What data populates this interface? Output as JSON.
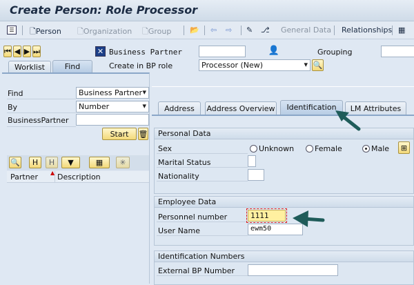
{
  "title": "Create Person: Role Processor",
  "toolbar": {
    "person": "Person",
    "organization": "Organization",
    "group": "Group",
    "general_data": "General Data",
    "relationships": "Relationships"
  },
  "header": {
    "bp_label": "Business Partner",
    "bp_value": "",
    "grouping_label": "Grouping",
    "grouping_value": "",
    "role_label": "Create in BP role",
    "role_value": "Processor (New)"
  },
  "left": {
    "tabs": [
      "Worklist",
      "Find"
    ],
    "active_tab": "Find",
    "find_label": "Find",
    "find_value": "Business Partner",
    "by_label": "By",
    "by_value": "Number",
    "bp_label": "BusinessPartner",
    "bp_value": "",
    "start": "Start",
    "columns": [
      "Partner",
      "Description"
    ]
  },
  "tabs": {
    "items": [
      "Address",
      "Address Overview",
      "Identification",
      "LM Attributes"
    ],
    "active": "Identification"
  },
  "personal": {
    "title": "Personal Data",
    "sex_label": "Sex",
    "sex_options": [
      "Unknown",
      "Female",
      "Male"
    ],
    "sex_selected": "Male",
    "marital_label": "Marital Status",
    "marital_value": "",
    "nationality_label": "Nationality",
    "nationality_value": ""
  },
  "employee": {
    "title": "Employee Data",
    "personnel_label": "Personnel number",
    "personnel_value": "1111",
    "user_label": "User Name",
    "user_value": "ewm50"
  },
  "idnums": {
    "title": "Identification Numbers",
    "ext_label": "External BP Number",
    "ext_value": ""
  },
  "colors": {
    "arrow": "#1f5c5a",
    "highlight": "#fff0a0"
  }
}
